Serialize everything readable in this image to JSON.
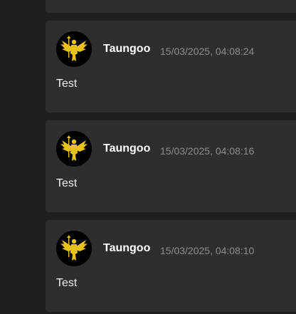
{
  "colors": {
    "background": "#1f1f1f",
    "card": "#2e2e2e",
    "author": "#ffffff",
    "timestamp": "#8e8e8e",
    "emblem": "#e7c21a"
  },
  "posts": [
    {
      "author": "Taungoo",
      "timestamp": "15/03/2025, 04:08:24",
      "text": "Test",
      "avatar_icon": "golden-winged-figure-icon"
    },
    {
      "author": "Taungoo",
      "timestamp": "15/03/2025, 04:08:16",
      "text": "Test",
      "avatar_icon": "golden-winged-figure-icon"
    },
    {
      "author": "Taungoo",
      "timestamp": "15/03/2025, 04:08:10",
      "text": "Test",
      "avatar_icon": "golden-winged-figure-icon"
    }
  ]
}
